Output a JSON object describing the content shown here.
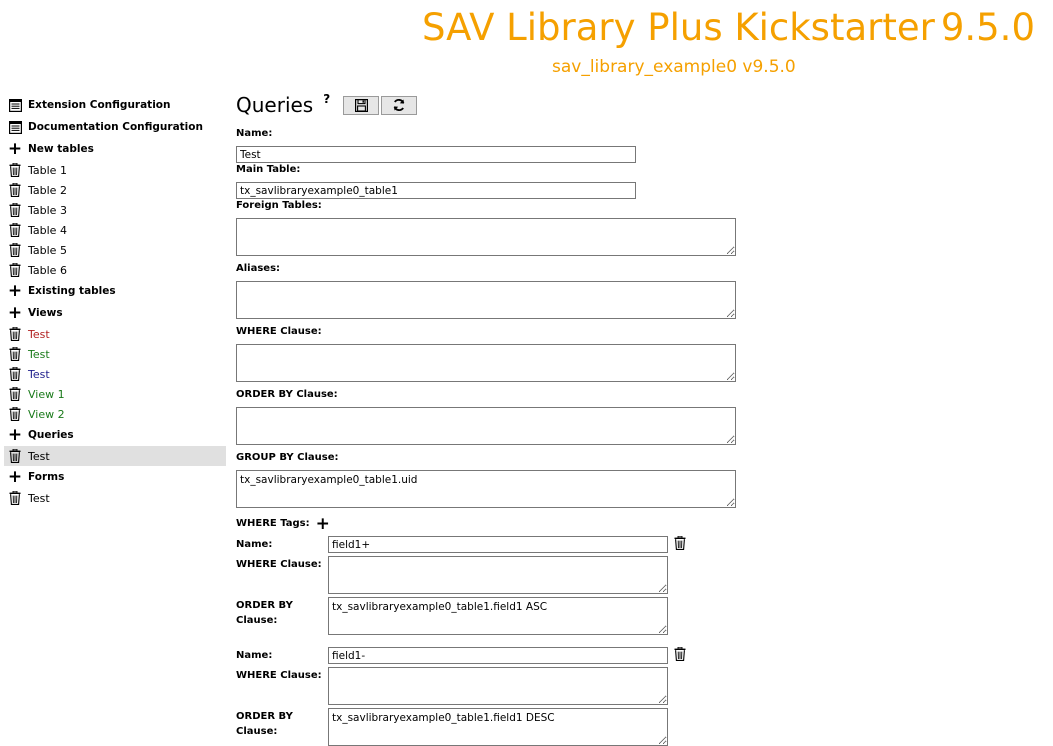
{
  "header": {
    "title": "SAV Library Plus Kickstarter",
    "version": "9.5.0",
    "subtitle": "sav_library_example0 v9.5.0"
  },
  "colors": {
    "accent": "#f5a000",
    "red": "#b22222",
    "green": "#1a7a1a",
    "blue": "#1e1e8c",
    "selected_bg": "#e0e0e0"
  },
  "sidebar": {
    "items": [
      {
        "label": "Extension Configuration",
        "type": "doc",
        "bold": true
      },
      {
        "label": "Documentation Configuration",
        "type": "doc",
        "bold": true
      },
      {
        "label": "New tables",
        "type": "plus",
        "bold": true
      },
      {
        "label": "Table 1",
        "type": "trash"
      },
      {
        "label": "Table 2",
        "type": "trash"
      },
      {
        "label": "Table 3",
        "type": "trash"
      },
      {
        "label": "Table 4",
        "type": "trash"
      },
      {
        "label": "Table 5",
        "type": "trash"
      },
      {
        "label": "Table 6",
        "type": "trash"
      },
      {
        "label": "Existing tables",
        "type": "plus",
        "bold": true
      },
      {
        "label": "Views",
        "type": "plus",
        "bold": true
      },
      {
        "label": "Test",
        "type": "trash",
        "color": "red"
      },
      {
        "label": "Test",
        "type": "trash",
        "color": "green"
      },
      {
        "label": "Test",
        "type": "trash",
        "color": "blue"
      },
      {
        "label": "View 1",
        "type": "trash",
        "color": "green"
      },
      {
        "label": "View 2",
        "type": "trash",
        "color": "green"
      },
      {
        "label": "Queries",
        "type": "plus",
        "bold": true
      },
      {
        "label": "Test",
        "type": "trash",
        "selected": true
      },
      {
        "label": "Forms",
        "type": "plus",
        "bold": true
      },
      {
        "label": "Test",
        "type": "trash"
      }
    ]
  },
  "main": {
    "title": "Queries",
    "help": "?",
    "save_icon": "save-icon",
    "refresh_icon": "refresh-icon",
    "fields": {
      "name_label": "Name:",
      "name_value": "Test",
      "main_table_label": "Main Table:",
      "main_table_value": "tx_savlibraryexample0_table1",
      "foreign_tables_label": "Foreign Tables:",
      "foreign_tables_value": "",
      "aliases_label": "Aliases:",
      "aliases_value": "",
      "where_label": "WHERE Clause:",
      "where_value": "",
      "order_by_label": "ORDER BY Clause:",
      "order_by_value": "",
      "group_by_label": "GROUP BY Clause:",
      "group_by_value": "tx_savlibraryexample0_table1.uid"
    },
    "where_tags": {
      "label": "WHERE Tags:",
      "name_label": "Name:",
      "where_label": "WHERE Clause:",
      "order_label_1": "ORDER BY",
      "order_label_2": "Clause:",
      "tags": [
        {
          "name": "field1+",
          "where": "",
          "order": "tx_savlibraryexample0_table1.field1 ASC"
        },
        {
          "name": "field1-",
          "where": "",
          "order": "tx_savlibraryexample0_table1.field1 DESC"
        }
      ]
    }
  }
}
